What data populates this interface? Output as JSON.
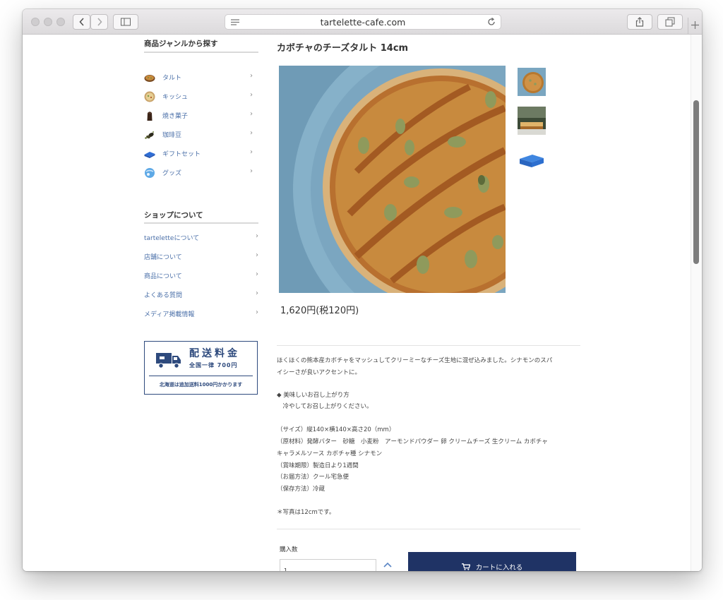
{
  "browser": {
    "url": "tartelette-cafe.com"
  },
  "sidebar": {
    "genre_heading": "商品ジャンルから探す",
    "genres": [
      {
        "label": "タルト",
        "icon": "tart-icon"
      },
      {
        "label": "キッシュ",
        "icon": "quiche-icon"
      },
      {
        "label": "焼き菓子",
        "icon": "baked-goods-icon"
      },
      {
        "label": "珈琲豆",
        "icon": "coffee-beans-icon"
      },
      {
        "label": "ギフトセット",
        "icon": "gift-box-icon"
      },
      {
        "label": "グッズ",
        "icon": "goods-icon"
      }
    ],
    "shop_heading": "ショップについて",
    "shop_links": [
      {
        "label": "tarteletteについて"
      },
      {
        "label": "店舗について"
      },
      {
        "label": "商品について"
      },
      {
        "label": "よくある質問"
      },
      {
        "label": "メディア掲載情報"
      }
    ],
    "chevron": "›",
    "shipping": {
      "title": "配送料金",
      "subtitle": "全国一律 700円",
      "note": "北海道は追加送料1000円かかります"
    }
  },
  "product": {
    "title": "カボチャのチーズタルト 14cm",
    "price": "1,620円(税120円)",
    "description": [
      "ほくほくの熊本産カボチャをマッシュしてクリーミーなチーズ生地に混ぜ込みました。シナモンのスパ",
      "イシーさが良いアクセントに。",
      "",
      "◆ 美味しいお召し上がり方",
      "　冷やしてお召し上がりください。",
      "",
      "（サイズ）縦140×横140×高さ20（mm）",
      "（原材料）発酵バター　砂糖　小麦粉　アーモンドパウダー 卵 クリームチーズ 生クリーム カボチャ",
      "キャラメルソース カボチャ種 シナモン",
      "（賞味期限）製造日より1週間",
      "（お届方法）クール宅急便",
      "（保存方法）冷蔵",
      "",
      "＊写真は12cmです。"
    ],
    "quantity_label": "購入数",
    "quantity_value": "1",
    "cart_button": "カートに入れる"
  },
  "colors": {
    "link": "#4a6fa8",
    "accent_navy": "#1f3365",
    "shipping_navy": "#2e4a7d"
  }
}
